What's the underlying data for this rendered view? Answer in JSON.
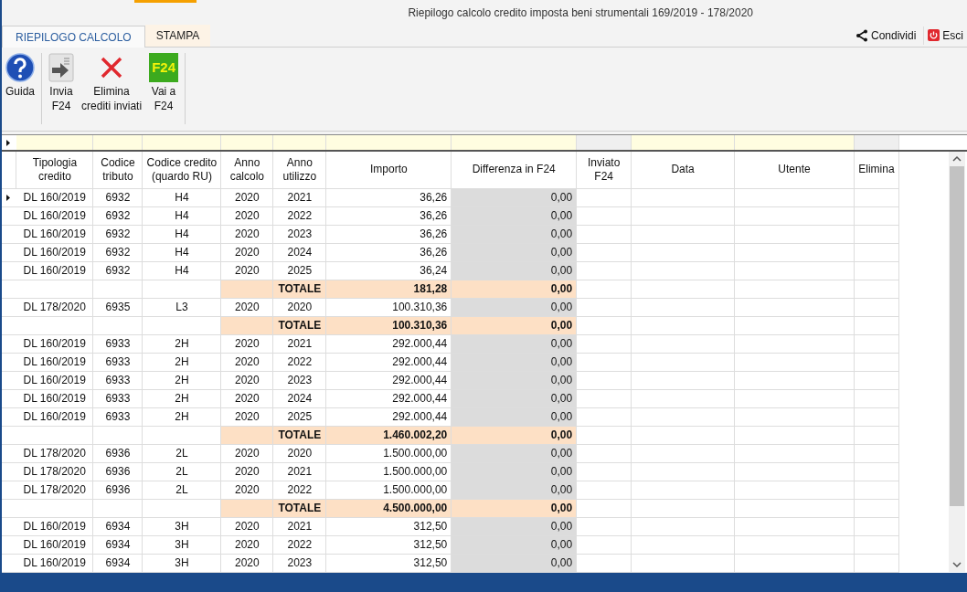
{
  "window": {
    "title": "Riepilogo calcolo credito imposta beni strumentali 169/2019 - 178/2020"
  },
  "tabs": [
    {
      "label": "RIEPILOGO CALCOLO",
      "selected": true
    },
    {
      "label": "STAMPA",
      "selected": false
    }
  ],
  "top_actions": [
    {
      "kind": "share",
      "label": "Condividi"
    },
    {
      "kind": "exit",
      "label": "Esci"
    }
  ],
  "toolbar": [
    {
      "kind": "help",
      "label": "Guida"
    },
    {
      "kind": "send",
      "label": "Invia\nF24"
    },
    {
      "kind": "delete",
      "label": "Elimina\ncrediti inviati"
    },
    {
      "kind": "f24",
      "label": "Vai a\nF24",
      "logo_text": "F24"
    }
  ],
  "table": {
    "columns": [
      "Tipologia credito",
      "Codice tributo",
      "Codice credito (quardo RU)",
      "Anno calcolo",
      "Anno utilizzo",
      "Importo",
      "Differenza in F24",
      "Inviato F24",
      "Data",
      "Utente",
      "Elimina"
    ],
    "rows": [
      {
        "kind": "data",
        "current": true,
        "cells": [
          "DL 160/2019",
          "6932",
          "H4",
          "2020",
          "2021",
          "36,26",
          "0,00"
        ]
      },
      {
        "kind": "data",
        "current": false,
        "cells": [
          "DL 160/2019",
          "6932",
          "H4",
          "2020",
          "2022",
          "36,26",
          "0,00"
        ]
      },
      {
        "kind": "data",
        "current": false,
        "cells": [
          "DL 160/2019",
          "6932",
          "H4",
          "2020",
          "2023",
          "36,26",
          "0,00"
        ]
      },
      {
        "kind": "data",
        "current": false,
        "cells": [
          "DL 160/2019",
          "6932",
          "H4",
          "2020",
          "2024",
          "36,26",
          "0,00"
        ]
      },
      {
        "kind": "data",
        "current": false,
        "cells": [
          "DL 160/2019",
          "6932",
          "H4",
          "2020",
          "2025",
          "36,24",
          "0,00"
        ]
      },
      {
        "kind": "total",
        "label": "TOTALE",
        "amount": "181,28",
        "difference": "0,00"
      },
      {
        "kind": "data",
        "current": false,
        "cells": [
          "DL 178/2020",
          "6935",
          "L3",
          "2020",
          "2020",
          "100.310,36",
          "0,00"
        ]
      },
      {
        "kind": "total",
        "label": "TOTALE",
        "amount": "100.310,36",
        "difference": "0,00"
      },
      {
        "kind": "data",
        "current": false,
        "cells": [
          "DL 160/2019",
          "6933",
          "2H",
          "2020",
          "2021",
          "292.000,44",
          "0,00"
        ]
      },
      {
        "kind": "data",
        "current": false,
        "cells": [
          "DL 160/2019",
          "6933",
          "2H",
          "2020",
          "2022",
          "292.000,44",
          "0,00"
        ]
      },
      {
        "kind": "data",
        "current": false,
        "cells": [
          "DL 160/2019",
          "6933",
          "2H",
          "2020",
          "2023",
          "292.000,44",
          "0,00"
        ]
      },
      {
        "kind": "data",
        "current": false,
        "cells": [
          "DL 160/2019",
          "6933",
          "2H",
          "2020",
          "2024",
          "292.000,44",
          "0,00"
        ]
      },
      {
        "kind": "data",
        "current": false,
        "cells": [
          "DL 160/2019",
          "6933",
          "2H",
          "2020",
          "2025",
          "292.000,44",
          "0,00"
        ]
      },
      {
        "kind": "total",
        "label": "TOTALE",
        "amount": "1.460.002,20",
        "difference": "0,00"
      },
      {
        "kind": "data",
        "current": false,
        "cells": [
          "DL 178/2020",
          "6936",
          "2L",
          "2020",
          "2020",
          "1.500.000,00",
          "0,00"
        ]
      },
      {
        "kind": "data",
        "current": false,
        "cells": [
          "DL 178/2020",
          "6936",
          "2L",
          "2020",
          "2021",
          "1.500.000,00",
          "0,00"
        ]
      },
      {
        "kind": "data",
        "current": false,
        "cells": [
          "DL 178/2020",
          "6936",
          "2L",
          "2020",
          "2022",
          "1.500.000,00",
          "0,00"
        ]
      },
      {
        "kind": "total",
        "label": "TOTALE",
        "amount": "4.500.000,00",
        "difference": "0,00"
      },
      {
        "kind": "data",
        "current": false,
        "cells": [
          "DL 160/2019",
          "6934",
          "3H",
          "2020",
          "2021",
          "312,50",
          "0,00"
        ]
      },
      {
        "kind": "data",
        "current": false,
        "cells": [
          "DL 160/2019",
          "6934",
          "3H",
          "2020",
          "2022",
          "312,50",
          "0,00"
        ]
      },
      {
        "kind": "data",
        "current": false,
        "cells": [
          "DL 160/2019",
          "6934",
          "3H",
          "2020",
          "2023",
          "312,50",
          "0,00"
        ]
      }
    ]
  }
}
